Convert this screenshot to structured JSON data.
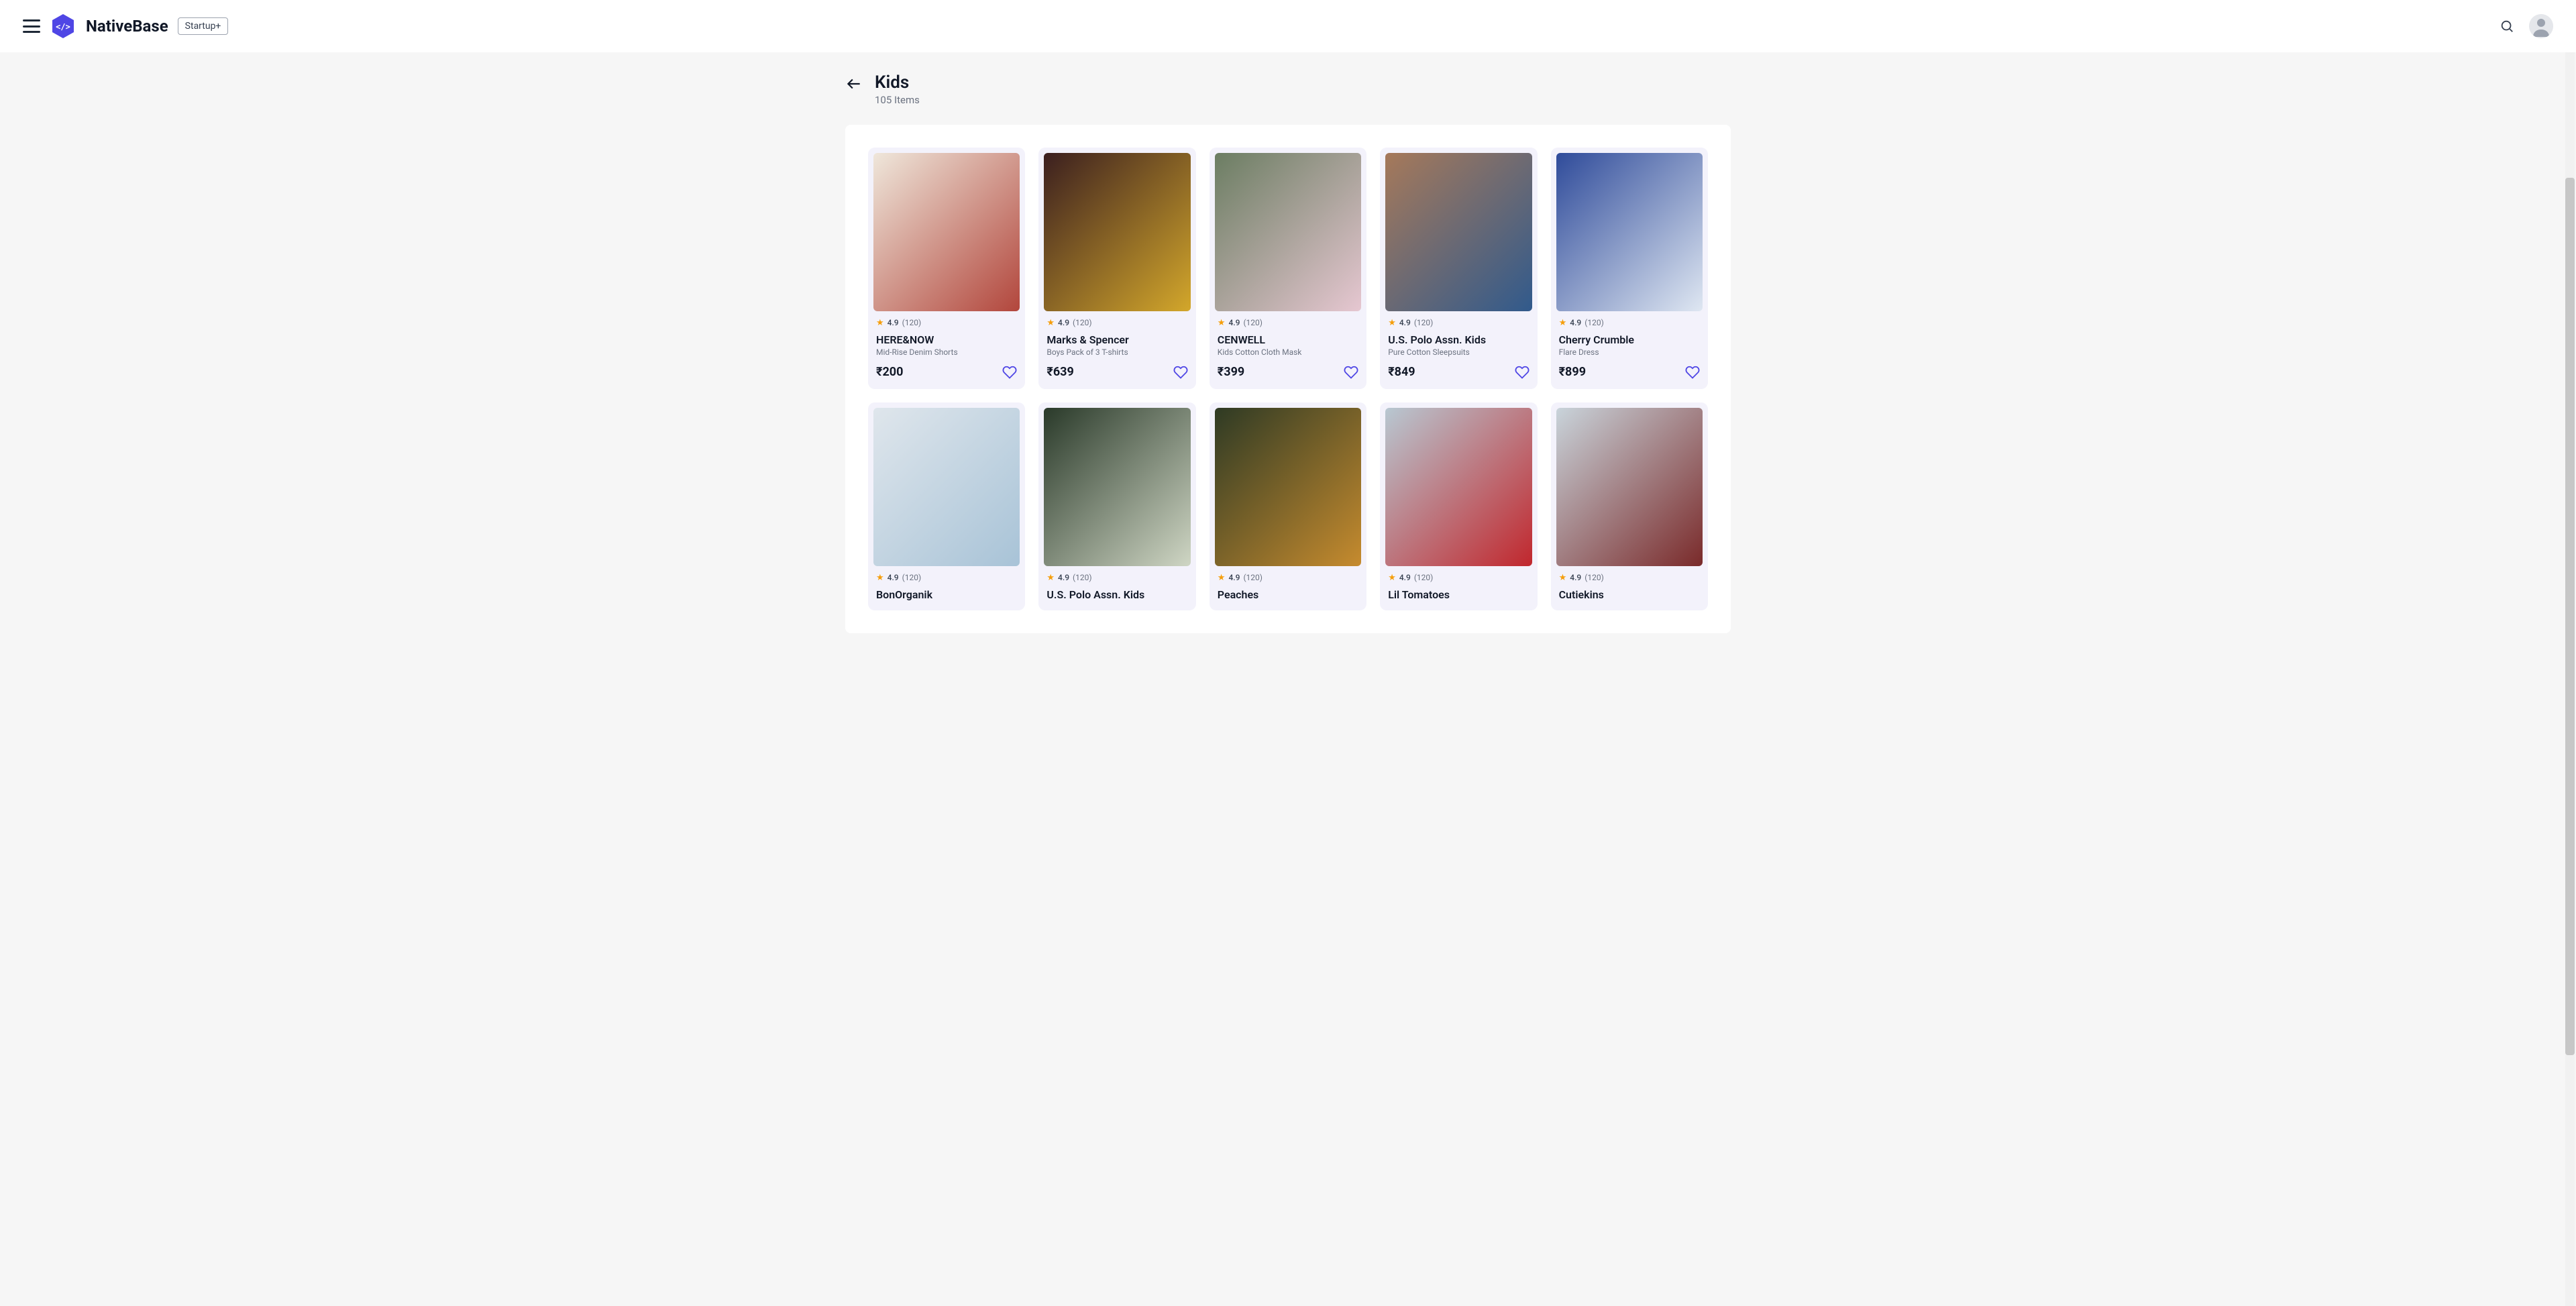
{
  "header": {
    "brand": "NativeBase",
    "badge": "Startup+"
  },
  "page": {
    "title": "Kids",
    "subtitle": "105 Items"
  },
  "currency": "₹",
  "products": [
    {
      "rating": "4.9",
      "count": "(120)",
      "brand": "HERE&NOW",
      "desc": "Mid-Rise Denim Shorts",
      "price": "200"
    },
    {
      "rating": "4.9",
      "count": "(120)",
      "brand": "Marks & Spencer",
      "desc": "Boys Pack of 3 T-shirts",
      "price": "639"
    },
    {
      "rating": "4.9",
      "count": "(120)",
      "brand": "CENWELL",
      "desc": "Kids Cotton Cloth Mask",
      "price": "399"
    },
    {
      "rating": "4.9",
      "count": "(120)",
      "brand": "U.S. Polo Assn. Kids",
      "desc": "Pure Cotton Sleepsuits",
      "price": "849"
    },
    {
      "rating": "4.9",
      "count": "(120)",
      "brand": "Cherry Crumble",
      "desc": "Flare Dress",
      "price": "899"
    },
    {
      "rating": "4.9",
      "count": "(120)",
      "brand": "BonOrganik",
      "desc": "",
      "price": ""
    },
    {
      "rating": "4.9",
      "count": "(120)",
      "brand": "U.S. Polo Assn. Kids",
      "desc": "",
      "price": ""
    },
    {
      "rating": "4.9",
      "count": "(120)",
      "brand": "Peaches",
      "desc": "",
      "price": ""
    },
    {
      "rating": "4.9",
      "count": "(120)",
      "brand": "Lil Tomatoes",
      "desc": "",
      "price": ""
    },
    {
      "rating": "4.9",
      "count": "(120)",
      "brand": "Cutiekins",
      "desc": "",
      "price": ""
    }
  ]
}
